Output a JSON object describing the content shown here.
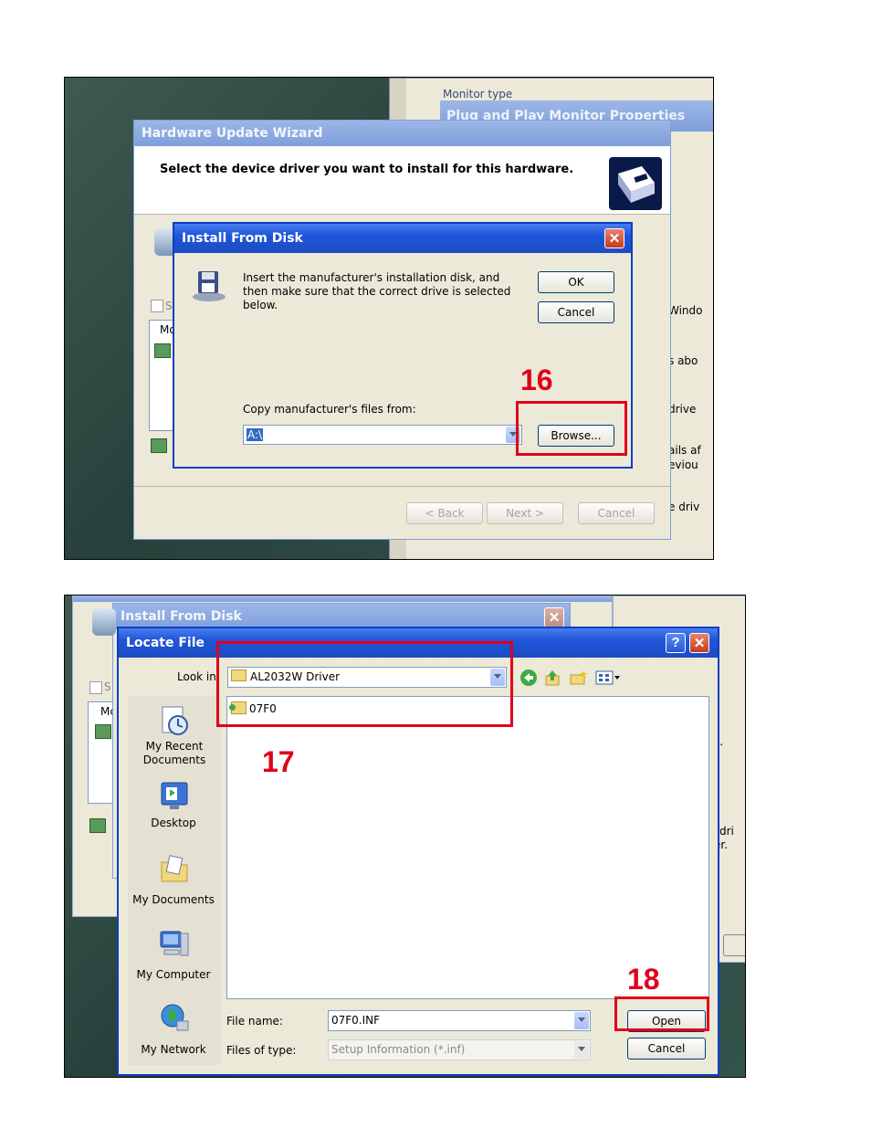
{
  "screenshot1": {
    "bg_window": {
      "groupbox_label": "Monitor type",
      "title": "Plug and Play Monitor Properties",
      "side_text": [
        "Windo",
        "s abo",
        "drive",
        "ails af",
        "eviou",
        "e driv"
      ]
    },
    "wizard": {
      "title": "Hardware Update Wizard",
      "header_text": "Select the device driver you want to install for this hardware.",
      "partial_labels": [
        "S",
        "Mo"
      ],
      "back_button": "< Back",
      "next_button": "Next >",
      "cancel_button": "Cancel"
    },
    "dialog": {
      "title": "Install From Disk",
      "close_glyph": "✕",
      "instruction": "Insert the manufacturer's installation disk, and then make sure that the correct drive is selected below.",
      "ok_button": "OK",
      "cancel_button": "Cancel",
      "copy_label": "Copy manufacturer's files from:",
      "copy_value": "A:\\",
      "browse_button": "Browse..."
    },
    "step_label": "16"
  },
  "screenshot2": {
    "bg_dialog": {
      "title": "Install From Disk",
      "close_glyph": "✕",
      "partial_labels": [
        "S",
        "Mc"
      ],
      "side_text": [
        "s.",
        "dri",
        "er."
      ]
    },
    "locate_file": {
      "title": "Locate File",
      "help_glyph": "?",
      "close_glyph": "✕",
      "look_in_label": "Look in:",
      "look_in_value": "AL2032W Driver",
      "places": [
        {
          "label": "My Recent Documents",
          "icon": "recent-documents-icon"
        },
        {
          "label": "Desktop",
          "icon": "desktop-icon"
        },
        {
          "label": "My Documents",
          "icon": "my-documents-icon"
        },
        {
          "label": "My Computer",
          "icon": "my-computer-icon"
        },
        {
          "label": "My Network",
          "icon": "my-network-icon"
        }
      ],
      "files": [
        {
          "name": "07F0",
          "icon": "folder-icon"
        }
      ],
      "file_name_label": "File name:",
      "file_name_value": "07F0.INF",
      "file_type_label": "Files of type:",
      "file_type_value": "Setup Information (*.inf)",
      "open_button": "Open",
      "cancel_button": "Cancel"
    },
    "step_label_folder": "17",
    "step_label_open": "18"
  }
}
